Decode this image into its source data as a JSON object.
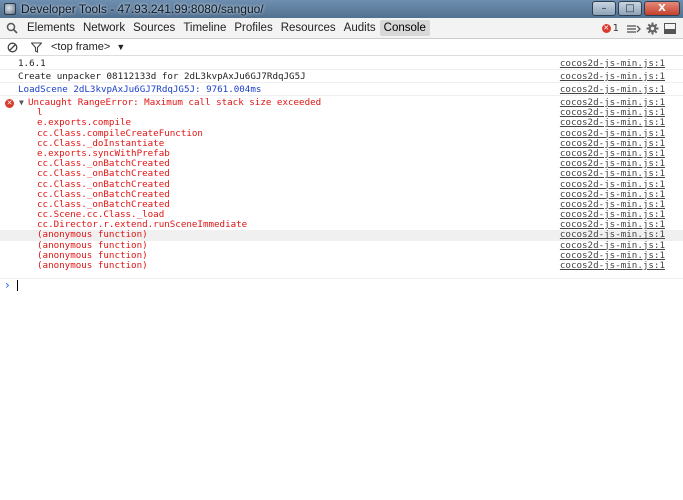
{
  "window": {
    "title": "Developer Tools - 47.93.241.99:8080/sanguo/",
    "minimize": "–",
    "maximize": "□",
    "close": "X"
  },
  "toolbar": {
    "tabs": [
      "Elements",
      "Network",
      "Sources",
      "Timeline",
      "Profiles",
      "Resources",
      "Audits",
      "Console"
    ],
    "selected_tab": "Console",
    "error_count": "1",
    "icons": [
      "search-icon",
      "dock-icon",
      "gear-icon",
      "drawer-icon"
    ]
  },
  "filter": {
    "frame": "<top frame>",
    "icons": [
      "clear-console-icon",
      "filter-icon"
    ]
  },
  "console": {
    "messages": [
      {
        "text": "1.6.1",
        "source": "cocos2d-js-min.js:1",
        "kind": "log"
      },
      {
        "text": "Create unpacker 08112133d for 2dL3kvpAxJu6GJ7RdqJG5J",
        "source": "cocos2d-js-min.js:1",
        "kind": "log"
      },
      {
        "text": "LoadScene 2dL3kvpAxJu6GJ7RdqJG5J: 9761.004ms",
        "source": "cocos2d-js-min.js:1",
        "kind": "info"
      }
    ],
    "error": {
      "text": "Uncaught RangeError: Maximum call stack size exceeded",
      "source": "cocos2d-js-min.js:1",
      "stack": [
        {
          "text": "l",
          "source": "cocos2d-js-min.js:1"
        },
        {
          "text": "e.exports.compile",
          "source": "cocos2d-js-min.js:1"
        },
        {
          "text": "cc.Class.compileCreateFunction",
          "source": "cocos2d-js-min.js:1"
        },
        {
          "text": "cc.Class._doInstantiate",
          "source": "cocos2d-js-min.js:1"
        },
        {
          "text": "e.exports.syncWithPrefab",
          "source": "cocos2d-js-min.js:1"
        },
        {
          "text": "cc.Class._onBatchCreated",
          "source": "cocos2d-js-min.js:1"
        },
        {
          "text": "cc.Class._onBatchCreated",
          "source": "cocos2d-js-min.js:1"
        },
        {
          "text": "cc.Class._onBatchCreated",
          "source": "cocos2d-js-min.js:1"
        },
        {
          "text": "cc.Class._onBatchCreated",
          "source": "cocos2d-js-min.js:1"
        },
        {
          "text": "cc.Class._onBatchCreated",
          "source": "cocos2d-js-min.js:1"
        },
        {
          "text": "cc.Scene.cc.Class._load",
          "source": "cocos2d-js-min.js:1"
        },
        {
          "text": "cc.Director.r.extend.runSceneImmediate",
          "source": "cocos2d-js-min.js:1"
        },
        {
          "text": "(anonymous function)",
          "source": "cocos2d-js-min.js:1"
        },
        {
          "text": "(anonymous function)",
          "source": "cocos2d-js-min.js:1"
        },
        {
          "text": "(anonymous function)",
          "source": "cocos2d-js-min.js:1"
        },
        {
          "text": "(anonymous function)",
          "source": "cocos2d-js-min.js:1"
        }
      ]
    },
    "prompt_symbol": "›"
  }
}
